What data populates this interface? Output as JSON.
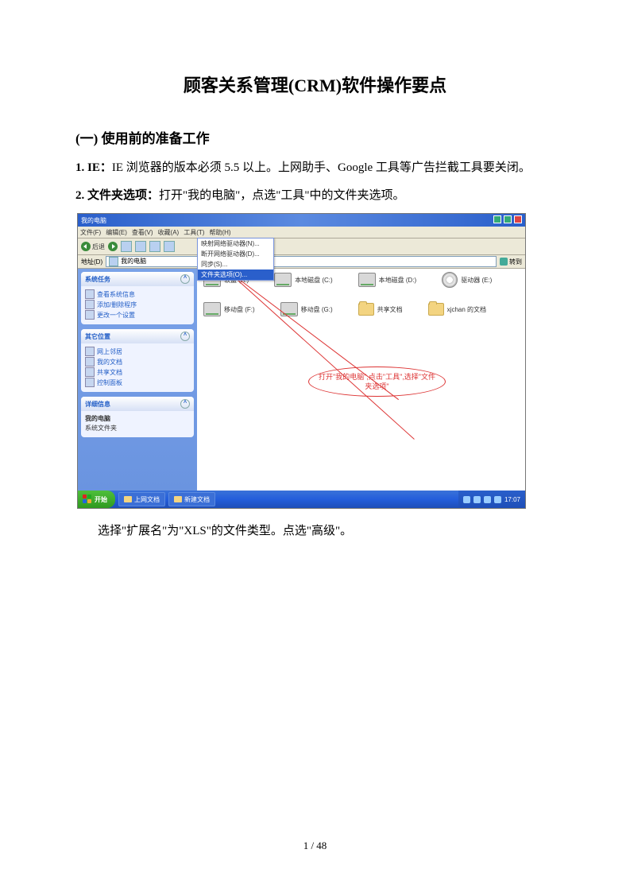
{
  "doc": {
    "title": "顾客关系管理(CRM)软件操作要点",
    "section1": "(一) 使用前的准备工作",
    "p1_prefix": "1. IE：",
    "p1_body": "IE 浏览器的版本必须 5.5 以上。上网助手、Google 工具等广告拦截工具要关闭。",
    "p2_prefix": "2. 文件夹选项：",
    "p2_body": "打开\"我的电脑\"，点选\"工具\"中的文件夹选项。",
    "after_shot": "选择\"扩展名\"为\"XLS\"的文件类型。点选\"高级\"。",
    "page_num": "1 / 48"
  },
  "shot": {
    "title": "我的电脑",
    "menus": [
      "文件(F)",
      "编辑(E)",
      "查看(V)",
      "收藏(A)",
      "工具(T)",
      "帮助(H)"
    ],
    "dropdown": {
      "items": [
        "映射网络驱动器(N)...",
        "断开网络驱动器(D)...",
        "同步(S)..."
      ],
      "selected": "文件夹选项(O)..."
    },
    "toolbar": {
      "back": "后退",
      "fwd": ""
    },
    "address": {
      "label": "地址(D)",
      "value": "我的电脑",
      "go": "转到"
    },
    "sidebar": {
      "p1": {
        "title": "系统任务",
        "items": [
          "查看系统信息",
          "添加/删除程序",
          "更改一个设置"
        ]
      },
      "p2": {
        "title": "其它位置",
        "items": [
          "网上邻居",
          "我的文档",
          "共享文档",
          "控制面板"
        ]
      },
      "p3": {
        "title": "详细信息",
        "items": [
          "我的电脑",
          "系统文件夹"
        ]
      }
    },
    "drives_row1": [
      "软盘 (A:)",
      "本地磁盘 (C:)",
      "本地磁盘 (D:)",
      "驱动器 (E:)"
    ],
    "drives_row2": [
      "移动盘 (F:)",
      "移动盘 (G:)",
      "共享文档",
      "xjchan 的文档"
    ],
    "annotation": "打开\"我的电脑\",点击\"工具\",选择\"文件夹选项\"",
    "taskbar": {
      "start": "开始",
      "apps": [
        "",
        "上网文档",
        "新建文档"
      ],
      "time": "17:07"
    }
  }
}
